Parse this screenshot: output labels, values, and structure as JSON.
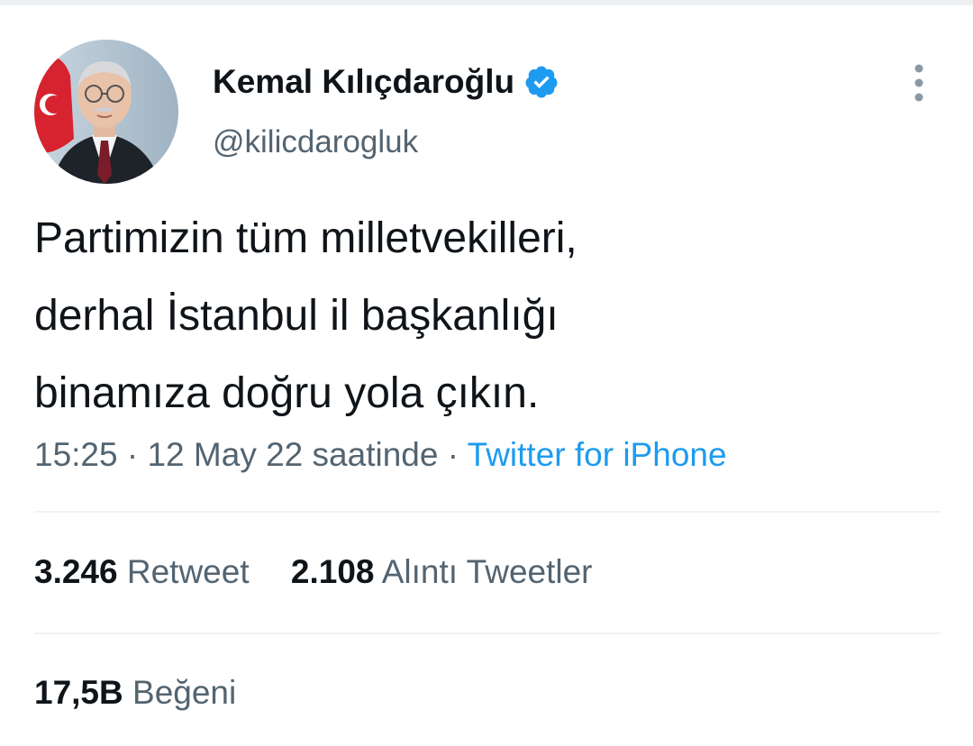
{
  "author": {
    "display_name": "Kemal Kılıçdaroğlu",
    "handle": "@kilicdarogluk",
    "verified_icon": "verified-badge-icon"
  },
  "tweet": {
    "lines": [
      "Partimizin tüm milletvekilleri,",
      "derhal İstanbul il başkanlığı",
      "binamıza doğru yola çıkın."
    ]
  },
  "meta": {
    "time": "15:25",
    "separator": " · ",
    "date": "12 May 22 saatinde",
    "source": "Twitter for iPhone"
  },
  "stats": {
    "retweets": {
      "count": "3.246",
      "label": "Retweet"
    },
    "quotes": {
      "count": "2.108",
      "label": "Alıntı Tweetler"
    },
    "likes": {
      "count": "17,5B",
      "label": "Beğeni"
    }
  },
  "colors": {
    "text": "#0f1419",
    "secondary": "#536471",
    "accent": "#1d9bf0",
    "divider": "#eff3f4"
  }
}
